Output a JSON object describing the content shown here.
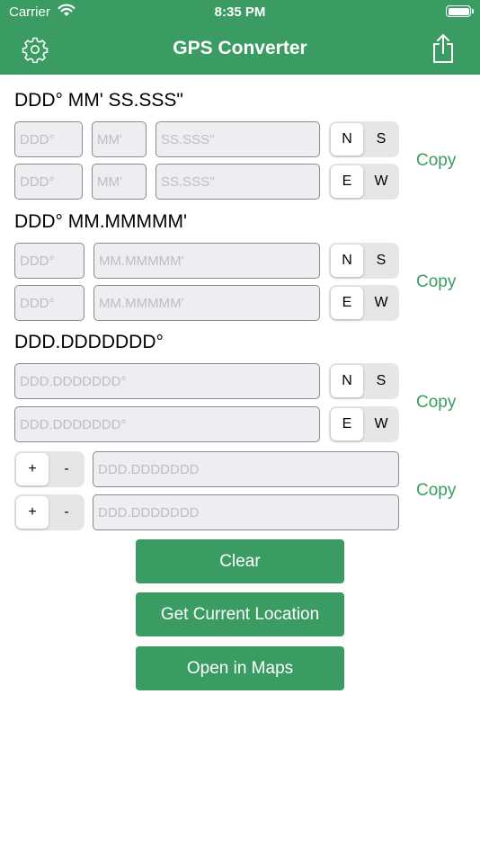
{
  "status_bar": {
    "carrier": "Carrier",
    "time": "8:35 PM"
  },
  "nav": {
    "title": "GPS Converter",
    "left_icon": "gear-icon",
    "right_icon": "share-icon"
  },
  "dms": {
    "title": "DDD° MM' SS.SSS\"",
    "lat": {
      "deg_placeholder": "DDD°",
      "min_placeholder": "MM'",
      "sec_placeholder": "SS.SSS\"",
      "options": [
        "N",
        "S"
      ],
      "selected": "N"
    },
    "lon": {
      "deg_placeholder": "DDD°",
      "min_placeholder": "MM'",
      "sec_placeholder": "SS.SSS\"",
      "options": [
        "E",
        "W"
      ],
      "selected": "E"
    },
    "copy_label": "Copy"
  },
  "dmm": {
    "title": "DDD° MM.MMMMM'",
    "lat": {
      "deg_placeholder": "DDD°",
      "min_placeholder": "MM.MMMMM'",
      "options": [
        "N",
        "S"
      ],
      "selected": "N"
    },
    "lon": {
      "deg_placeholder": "DDD°",
      "min_placeholder": "MM.MMMMM'",
      "options": [
        "E",
        "W"
      ],
      "selected": "E"
    },
    "copy_label": "Copy"
  },
  "dd": {
    "title": "DDD.DDDDDDD°",
    "lat": {
      "placeholder": "DDD.DDDDDDD°",
      "options": [
        "N",
        "S"
      ],
      "selected": "N"
    },
    "lon": {
      "placeholder": "DDD.DDDDDDD°",
      "options": [
        "E",
        "W"
      ],
      "selected": "E"
    },
    "copy_label": "Copy"
  },
  "signed": {
    "lat": {
      "placeholder": "DDD.DDDDDDD",
      "options": [
        "+",
        "-"
      ],
      "selected": "+"
    },
    "lon": {
      "placeholder": "DDD.DDDDDDD",
      "options": [
        "+",
        "-"
      ],
      "selected": "+"
    },
    "copy_label": "Copy"
  },
  "buttons": {
    "clear": "Clear",
    "current_location": "Get Current Location",
    "open_maps": "Open in Maps"
  },
  "colors": {
    "accent": "#3a9c63",
    "field_bg": "#eeeef2",
    "placeholder": "#bdbdc3"
  }
}
